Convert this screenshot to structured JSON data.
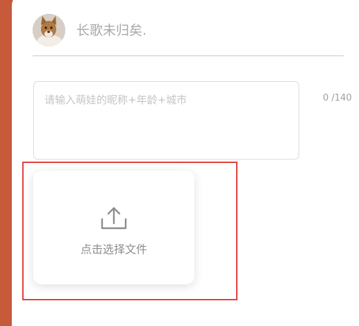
{
  "user": {
    "name": "长歌未归矣."
  },
  "post_input": {
    "placeholder": "请输入萌娃的昵称+年龄+城市",
    "counter": "0 /140"
  },
  "upload": {
    "label": "点击选择文件",
    "icon": "upload-icon"
  },
  "colors": {
    "background_accent": "#c65a3a",
    "highlight_border": "#e0403e"
  }
}
